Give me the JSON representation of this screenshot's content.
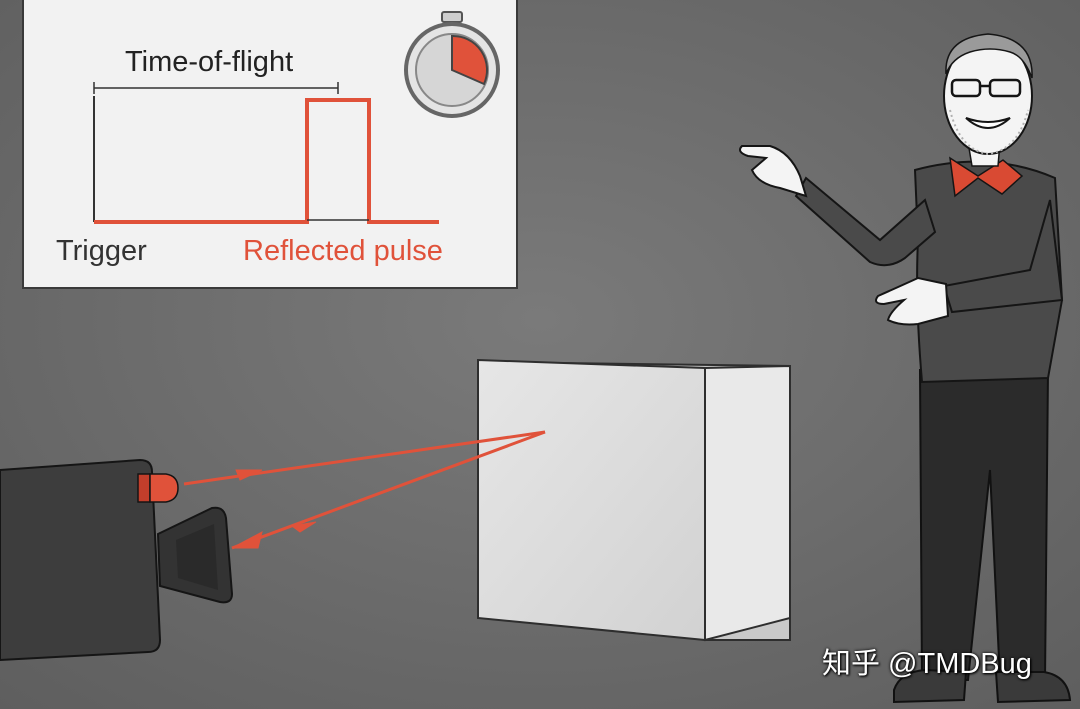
{
  "diagram": {
    "title": "Time-of-flight",
    "trigger_label": "Trigger",
    "reflected_pulse_label": "Reflected pulse"
  },
  "colors": {
    "background": "#6f6f6f",
    "signal": "#e0523a",
    "board": "#f2f2f2"
  },
  "watermark": "知乎 @TMDBug"
}
